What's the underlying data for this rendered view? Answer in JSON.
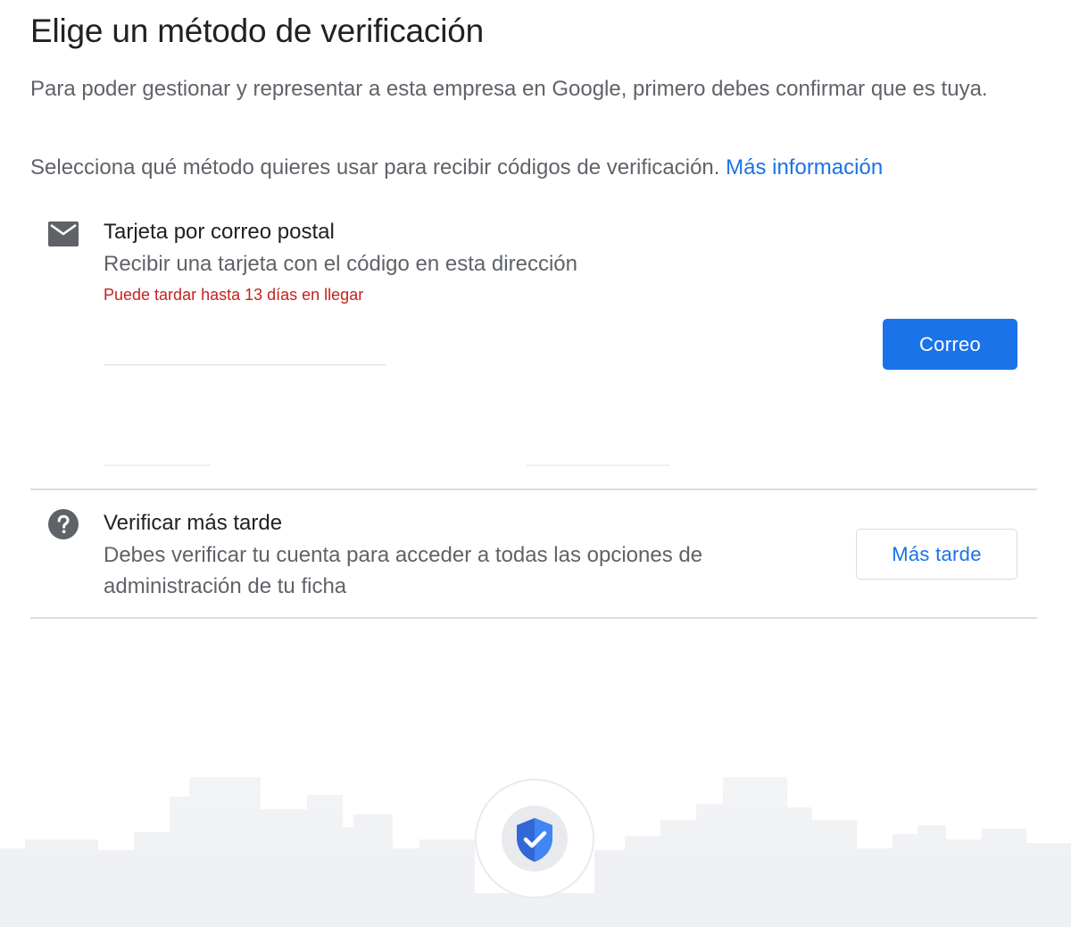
{
  "header": {
    "title": "Elige un método de verificación",
    "intro": "Para poder gestionar y representar a esta empresa en Google, primero debes confirmar que es tuya.",
    "select_text": "Selecciona qué método quieres usar para recibir códigos de verificación.",
    "more_info_link": "Más información"
  },
  "options": [
    {
      "icon": "mail-icon",
      "title": "Tarjeta por correo postal",
      "description": "Recibir una tarjeta con el código en esta dirección",
      "warning": "Puede tardar hasta 13 días en llegar",
      "button_label": "Correo"
    },
    {
      "icon": "help-icon",
      "title": "Verificar más tarde",
      "description": "Debes verificar tu cuenta para acceder a todas las opciones de administración de tu ficha",
      "button_label": "Más tarde"
    }
  ],
  "illustration": {
    "icon": "verified-shield-icon"
  },
  "colors": {
    "accent": "#1a73e8",
    "warning": "#c5221f",
    "text_primary": "#202124",
    "text_secondary": "#5f6368",
    "divider": "#dadce0"
  }
}
